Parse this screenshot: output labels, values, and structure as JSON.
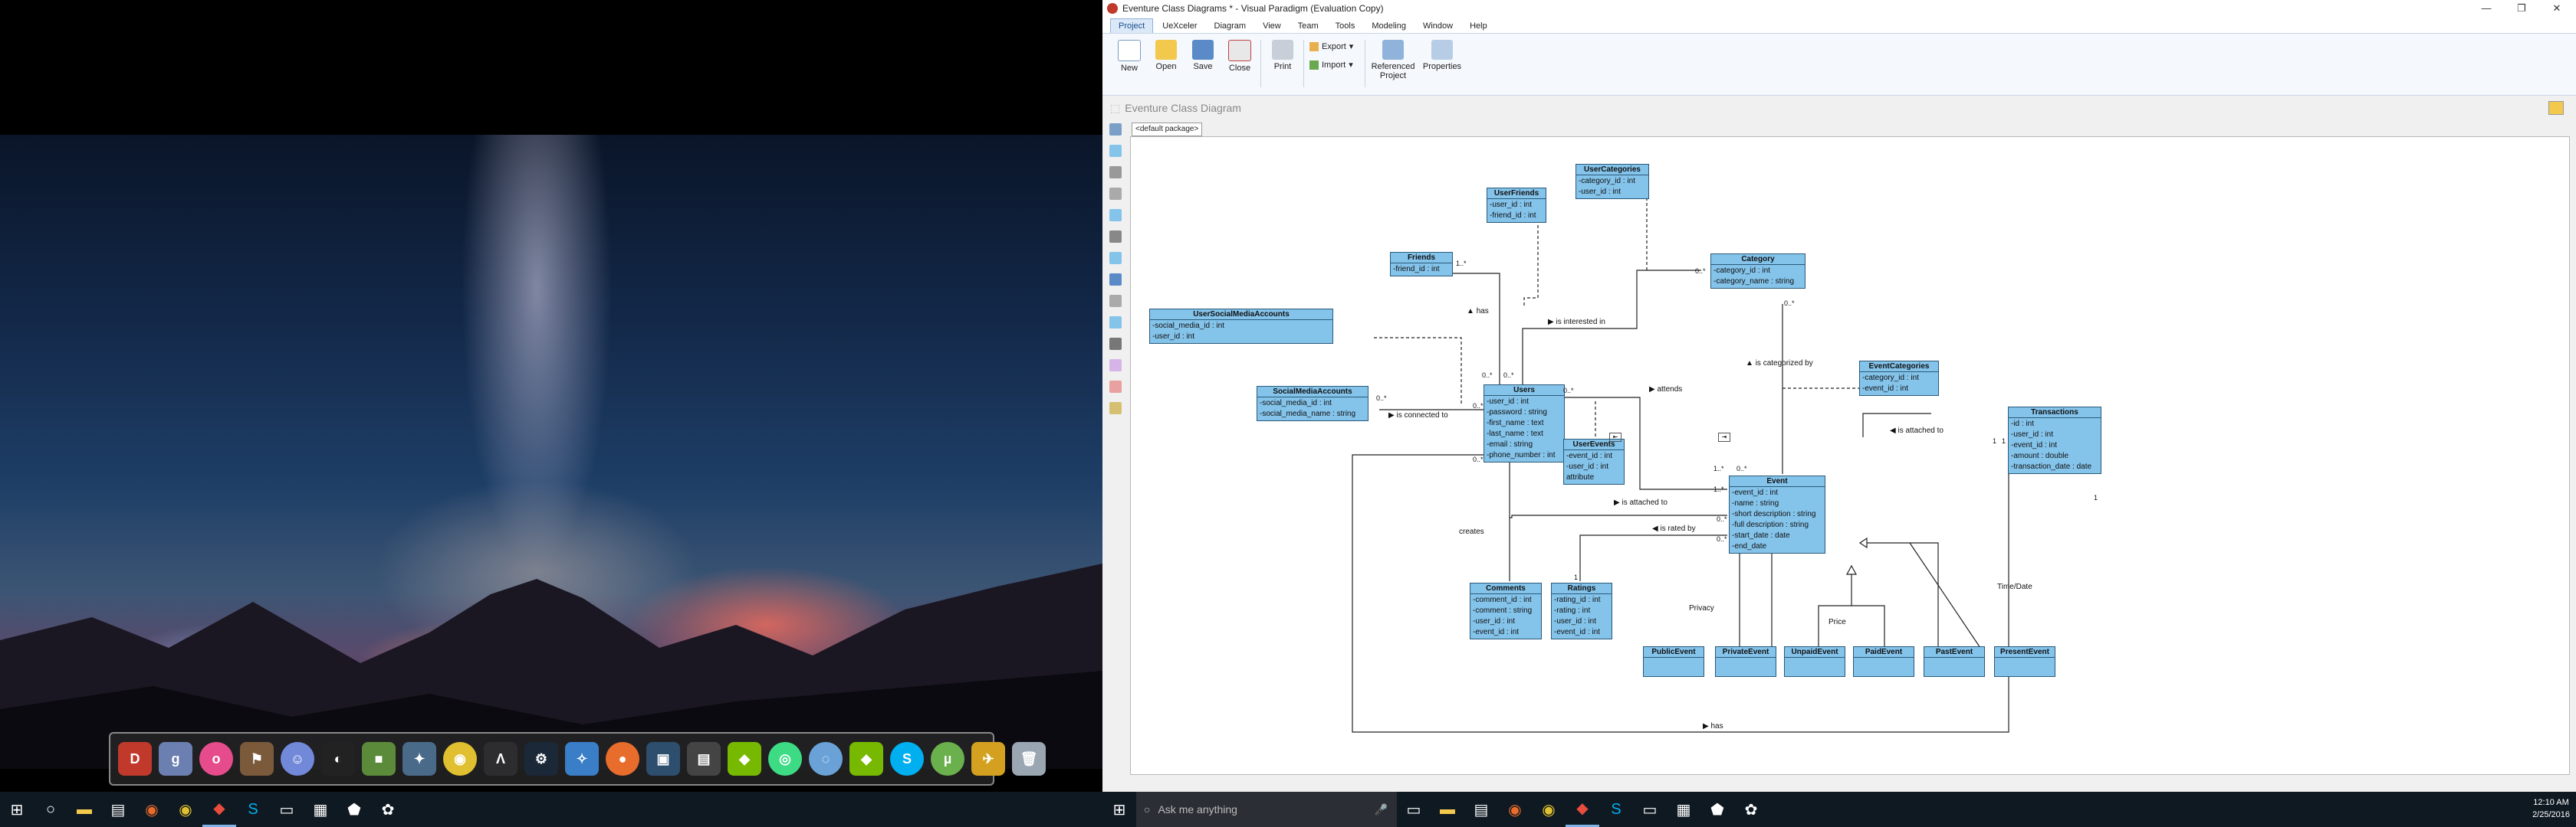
{
  "app": {
    "title": "Eventure Class Diagrams * - Visual Paradigm (Evaluation Copy)",
    "menu_tabs": [
      "Project",
      "UeXceler",
      "Diagram",
      "View",
      "Team",
      "Tools",
      "Modeling",
      "Window",
      "Help"
    ],
    "active_tab": "Project",
    "ribbon": {
      "new": "New",
      "open": "Open",
      "save": "Save",
      "close": "Close",
      "print": "Print",
      "export": "Export",
      "import": "Import",
      "referenced_project_1": "Referenced",
      "referenced_project_2": "Project",
      "properties": "Properties"
    },
    "diagram_name": "Eventure Class Diagram",
    "package_tab": "<default package>"
  },
  "classes": {
    "userfriends": {
      "name": "UserFriends",
      "attrs": [
        "-user_id : int",
        "-friend_id : int"
      ]
    },
    "usercategories": {
      "name": "UserCategories",
      "attrs": [
        "-category_id : int",
        "-user_id : int"
      ]
    },
    "friends": {
      "name": "Friends",
      "attrs": [
        "-friend_id : int"
      ]
    },
    "category": {
      "name": "Category",
      "attrs": [
        "-category_id : int",
        "-category_name : string"
      ]
    },
    "usersocialmediaaccounts": {
      "name": "UserSocialMediaAccounts",
      "attrs": [
        "-social_media_id : int",
        "-user_id : int"
      ]
    },
    "socialmediaaccounts": {
      "name": "SocialMediaAccounts",
      "attrs": [
        "-social_media_id : int",
        "-social_media_name : string"
      ]
    },
    "users": {
      "name": "Users",
      "attrs": [
        "-user_id : int",
        "-password : string",
        "-first_name : text",
        "-last_name : text",
        "-email : string",
        "-phone_number : int"
      ]
    },
    "eventcategories": {
      "name": "EventCategories",
      "attrs": [
        "-category_id : int",
        "-event_id : int"
      ]
    },
    "transactions": {
      "name": "Transactions",
      "attrs": [
        "-id : int",
        "-user_id : int",
        "-event_id : int",
        "-amount : double",
        "-transaction_date : date"
      ]
    },
    "userevents": {
      "name": "UserEvents",
      "attrs": [
        "-event_id : int",
        "-user_id : int",
        "attribute"
      ]
    },
    "event": {
      "name": "Event",
      "attrs": [
        "-event_id : int",
        "-name : string",
        "-short description : string",
        "-full description : string",
        "-start_date : date",
        "-end_date"
      ]
    },
    "comments": {
      "name": "Comments",
      "attrs": [
        "-comment_id : int",
        "-comment : string",
        "-user_id : int",
        "-event_id : int"
      ]
    },
    "ratings": {
      "name": "Ratings",
      "attrs": [
        "-rating_id : int",
        "-rating : int",
        "-user_id : int",
        "-event_id : int"
      ]
    },
    "publicevent": {
      "name": "PublicEvent",
      "attrs": []
    },
    "privateevent": {
      "name": "PrivateEvent",
      "attrs": []
    },
    "unpaidevent": {
      "name": "UnpaidEvent",
      "attrs": []
    },
    "paidevent": {
      "name": "PaidEvent",
      "attrs": []
    },
    "pastevent": {
      "name": "PastEvent",
      "attrs": []
    },
    "presentevent": {
      "name": "PresentEvent",
      "attrs": []
    }
  },
  "relations": {
    "has1": "has",
    "interested": "is interested in",
    "categorized": "is categorized by",
    "attends": "attends",
    "connected": "is connected to",
    "attached1": "is attached to",
    "attached2": "is attached to",
    "rated": "is rated by",
    "creates": "creates",
    "privacy": "Privacy",
    "price": "Price",
    "timedate": "Time/Date",
    "has2": "has"
  },
  "multiplicities": {
    "m1": "1..*",
    "m2": "0..*",
    "m3": "0..*",
    "m4": "0..*",
    "m5": "0..*",
    "m6": "0..*",
    "m7": "0..*",
    "m8": "1",
    "m9": "1..*",
    "m10": "0..*",
    "m11": "1",
    "m12": "1..*",
    "m13": "0..*",
    "m14": "0..*",
    "m15": "1",
    "m16": "1"
  },
  "taskbar": {
    "search_placeholder": "Ask me anything",
    "time": "12:10 AM",
    "date": "2/25/2016"
  },
  "colors": {
    "class_fill": "#84c3ea",
    "accent": "#1a4f8c"
  }
}
